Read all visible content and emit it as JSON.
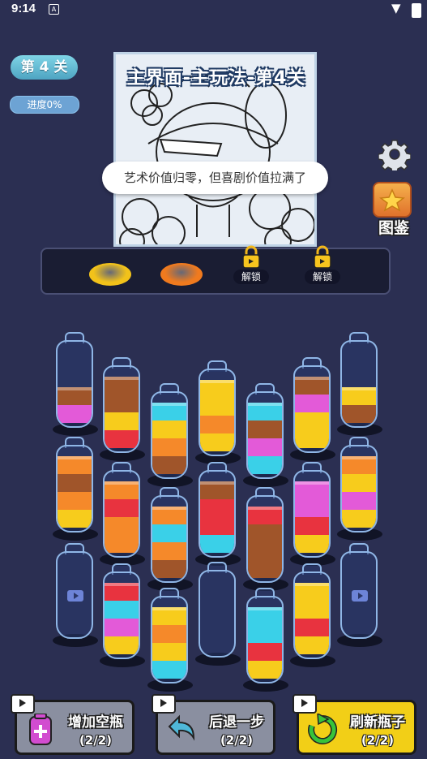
{
  "status_bar": {
    "time": "9:14",
    "notif_glyph": "A"
  },
  "level": {
    "label": "第 4 关",
    "progress": "进度0%"
  },
  "poster": {
    "title": "主界面-主玩法-第4关",
    "caption": "艺术价值归零，但喜剧价值拉满了"
  },
  "album_label": "图鉴",
  "tray": {
    "slots": [
      {
        "type": "disk",
        "color": "#f2c21a"
      },
      {
        "type": "disk",
        "color": "#f07a1e"
      },
      {
        "type": "locked",
        "label": "解锁"
      },
      {
        "type": "locked",
        "label": "解锁"
      }
    ]
  },
  "colors": {
    "brown": "#a0552a",
    "pink": "#e35ad8",
    "yellow": "#f7cc1c",
    "orange": "#f5892a",
    "red": "#e8333f",
    "cyan": "#3ad0e8",
    "background": "#2b2f52"
  },
  "bottles": [
    {
      "id": "b1",
      "layers": [
        "pink",
        "brown"
      ],
      "locked": false
    },
    {
      "id": "b2",
      "layers": [
        "red",
        "yellow",
        "brown",
        "brown"
      ],
      "locked": false
    },
    {
      "id": "b3",
      "layers": [
        "brown",
        "orange",
        "yellow",
        "cyan"
      ],
      "locked": false
    },
    {
      "id": "b4",
      "layers": [
        "yellow",
        "orange",
        "yellow",
        "yellow"
      ],
      "locked": false
    },
    {
      "id": "b5",
      "layers": [
        "cyan",
        "pink",
        "brown",
        "cyan"
      ],
      "locked": false
    },
    {
      "id": "b6",
      "layers": [
        "yellow",
        "yellow",
        "pink",
        "brown"
      ],
      "locked": false
    },
    {
      "id": "b7",
      "layers": [
        "brown",
        "yellow"
      ],
      "locked": false
    },
    {
      "id": "b8",
      "layers": [
        "yellow",
        "orange",
        "brown",
        "orange"
      ],
      "locked": false
    },
    {
      "id": "b9",
      "layers": [
        "orange",
        "orange",
        "red",
        "orange"
      ],
      "locked": false
    },
    {
      "id": "b10",
      "layers": [
        "brown",
        "orange",
        "cyan",
        "orange"
      ],
      "locked": false
    },
    {
      "id": "b11",
      "layers": [
        "cyan",
        "red",
        "red",
        "brown"
      ],
      "locked": false
    },
    {
      "id": "b12",
      "layers": [
        "brown",
        "brown",
        "brown",
        "red"
      ],
      "locked": false
    },
    {
      "id": "b13",
      "layers": [
        "yellow",
        "red",
        "pink",
        "pink"
      ],
      "locked": false
    },
    {
      "id": "b14",
      "layers": [
        "yellow",
        "pink",
        "yellow",
        "orange"
      ],
      "locked": false
    },
    {
      "id": "b15",
      "layers": [],
      "locked": true
    },
    {
      "id": "b16",
      "layers": [
        "yellow",
        "pink",
        "cyan",
        "red"
      ],
      "locked": false
    },
    {
      "id": "b17",
      "layers": [
        "cyan",
        "yellow",
        "orange",
        "yellow"
      ],
      "locked": false
    },
    {
      "id": "b18",
      "layers": [],
      "locked": false
    },
    {
      "id": "b19",
      "layers": [
        "yellow",
        "red",
        "cyan",
        "cyan"
      ],
      "locked": false
    },
    {
      "id": "b20",
      "layers": [
        "yellow",
        "red",
        "yellow",
        "yellow"
      ],
      "locked": false
    },
    {
      "id": "b21",
      "layers": [],
      "locked": true
    }
  ],
  "buttons": [
    {
      "label": "增加空瓶",
      "count": "(2/2)",
      "icon": "add-bottle-icon",
      "color": "#8a8fa0"
    },
    {
      "label": "后退一步",
      "count": "(2/2)",
      "icon": "undo-arrow-icon",
      "color": "#8a8fa0"
    },
    {
      "label": "刷新瓶子",
      "count": "(2/2)",
      "icon": "refresh-icon",
      "color": "#f2cf17"
    }
  ]
}
